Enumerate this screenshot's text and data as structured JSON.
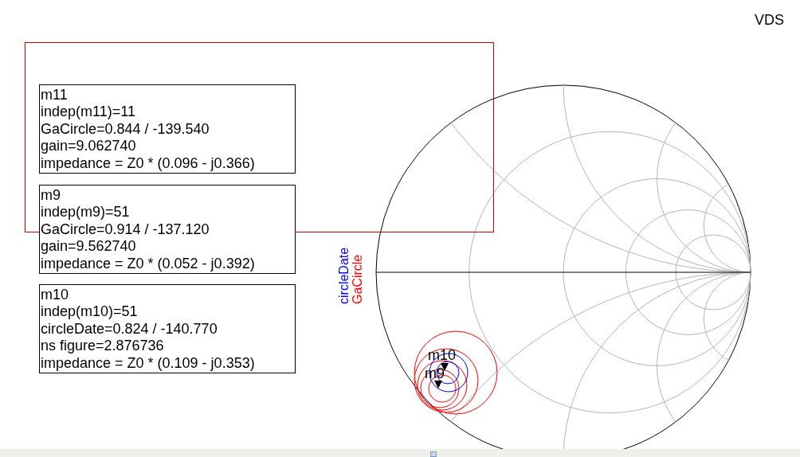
{
  "title": "VDS",
  "legend": [
    {
      "label": "circleDate",
      "color": "#0000ff"
    },
    {
      "label": "GaCircle",
      "color": "#ff0000"
    }
  ],
  "markers": [
    {
      "label": "m10"
    },
    {
      "label": "m9"
    }
  ],
  "readouts": [
    {
      "lines": [
        "m11",
        "indep(m11)=11",
        "GaCircle=0.844 / -139.540",
        "gain=9.062740",
        "impedance = Z0 * (0.096 - j0.366)"
      ]
    },
    {
      "lines": [
        "m9",
        "indep(m9)=51",
        "GaCircle=0.914 / -137.120",
        "gain=9.562740",
        "impedance = Z0 * (0.052 - j0.392)"
      ]
    },
    {
      "lines": [
        "m10",
        "indep(m10)=51",
        "circleDate=0.824 / -140.770",
        "ns figure=2.876736",
        "impedance = Z0 * (0.109 - j0.353)"
      ]
    }
  ]
}
